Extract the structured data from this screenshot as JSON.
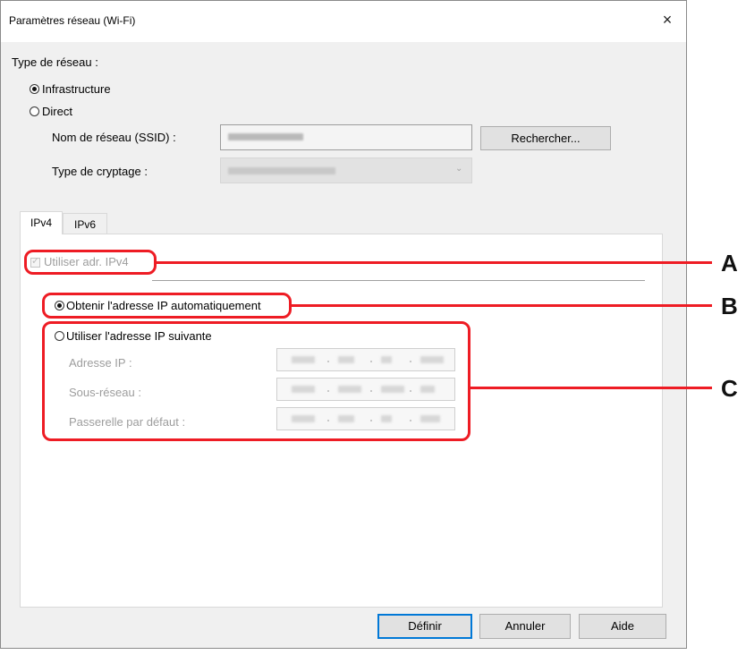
{
  "window": {
    "title": "Paramètres réseau (Wi-Fi)",
    "close_glyph": "×"
  },
  "network_type": {
    "label": "Type de réseau :",
    "options": [
      {
        "label": "Infrastructure",
        "selected": true
      },
      {
        "label": "Direct",
        "selected": false
      }
    ]
  },
  "ssid": {
    "label": "Nom de réseau (SSID) :",
    "search_button": "Rechercher..."
  },
  "encryption": {
    "label": "Type de cryptage :"
  },
  "tabs": [
    {
      "label": "IPv4",
      "active": true
    },
    {
      "label": "IPv6",
      "active": false
    }
  ],
  "ipv4": {
    "use_ipv4_label": "Utiliser adr. IPv4",
    "auto_ip_label": "Obtenir l'adresse IP automatiquement",
    "manual_ip_label": "Utiliser l'adresse IP suivante",
    "fields": [
      {
        "label": "Adresse IP :"
      },
      {
        "label": "Sous-réseau :"
      },
      {
        "label": "Passerelle par défaut :"
      }
    ]
  },
  "buttons": {
    "ok": "Définir",
    "cancel": "Annuler",
    "help": "Aide"
  },
  "annotations": [
    "A",
    "B",
    "C"
  ],
  "colors": {
    "annotation": "#ee1c24",
    "focus": "#0078d7"
  }
}
